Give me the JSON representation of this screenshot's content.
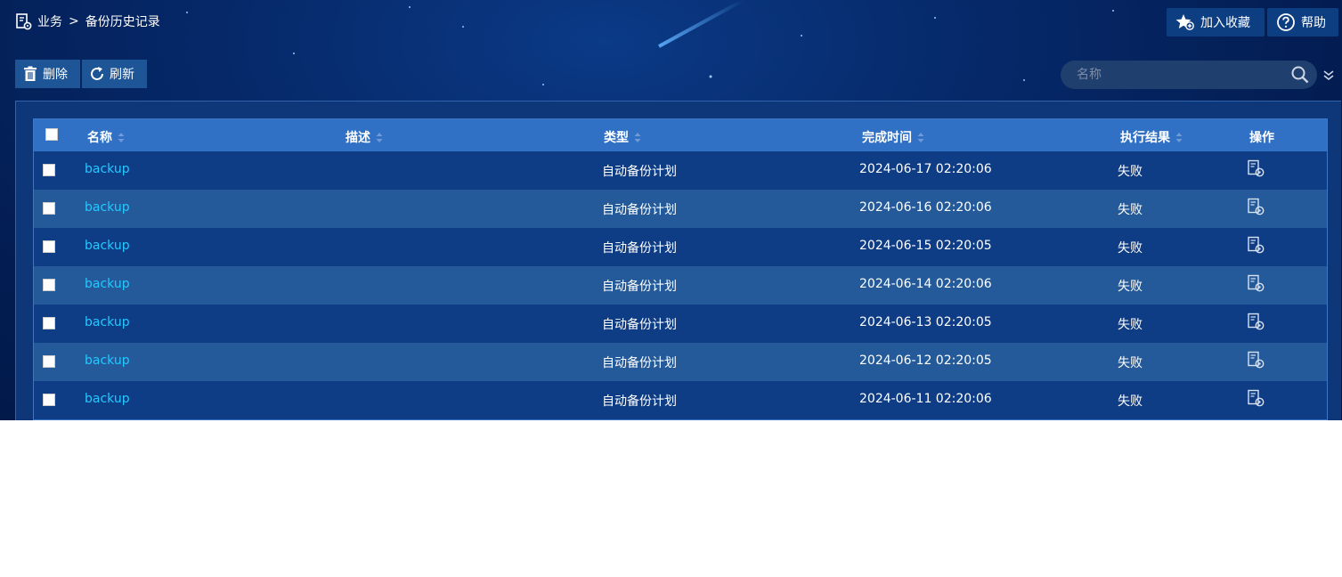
{
  "breadcrumb": {
    "root": "业务",
    "separator": ">",
    "current": "备份历史记录"
  },
  "topbar": {
    "favorite_label": "加入收藏",
    "help_label": "帮助"
  },
  "toolbar": {
    "delete_label": "删除",
    "refresh_label": "刷新"
  },
  "search": {
    "placeholder": "名称",
    "value": ""
  },
  "table": {
    "columns": [
      "名称",
      "描述",
      "类型",
      "完成时间",
      "执行结果",
      "操作"
    ],
    "rows": [
      {
        "name": "backup",
        "description": "",
        "type": "自动备份计划",
        "time": "2024-06-17 02:20:06",
        "result": "失败"
      },
      {
        "name": "backup",
        "description": "",
        "type": "自动备份计划",
        "time": "2024-06-16 02:20:06",
        "result": "失败"
      },
      {
        "name": "backup",
        "description": "",
        "type": "自动备份计划",
        "time": "2024-06-15 02:20:05",
        "result": "失败"
      },
      {
        "name": "backup",
        "description": "",
        "type": "自动备份计划",
        "time": "2024-06-14 02:20:06",
        "result": "失败"
      },
      {
        "name": "backup",
        "description": "",
        "type": "自动备份计划",
        "time": "2024-06-13 02:20:05",
        "result": "失败"
      },
      {
        "name": "backup",
        "description": "",
        "type": "自动备份计划",
        "time": "2024-06-12 02:20:05",
        "result": "失败"
      },
      {
        "name": "backup",
        "description": "",
        "type": "自动备份计划",
        "time": "2024-06-11 02:20:06",
        "result": "失败"
      }
    ]
  },
  "colors": {
    "link": "#25c8ff",
    "header": "#3071c5",
    "row_odd": "#0f3d85",
    "row_even": "#245a99"
  },
  "icons": {
    "breadcrumb": "document-gear-icon",
    "favorite": "star-plus-icon",
    "help": "question-circle-icon",
    "delete": "trash-icon",
    "refresh": "refresh-icon",
    "search": "search-icon",
    "expand": "double-chevron-down-icon",
    "sort": "sort-icon",
    "operation": "restore-icon"
  }
}
